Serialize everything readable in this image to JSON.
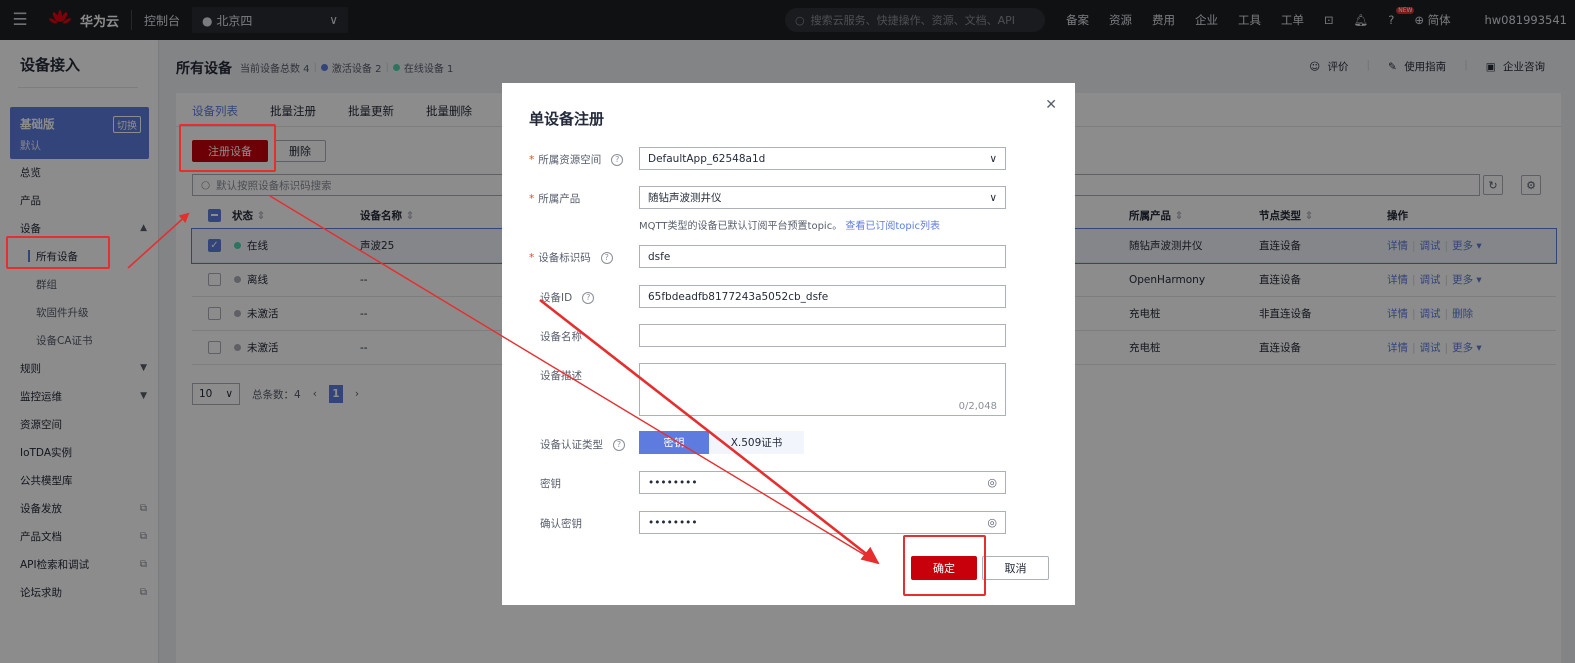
{
  "topbar": {
    "brand": "华为云",
    "console": "控制台",
    "region": "北京四",
    "search_placeholder": "搜索云服务、快捷操作、资源、文档、API",
    "nav": [
      "备案",
      "资源",
      "费用",
      "企业",
      "工具",
      "工单"
    ],
    "new_badge": "NEW",
    "language": "简体",
    "user": "hw081993541"
  },
  "sidebar": {
    "title": "设备接入",
    "edition": {
      "name": "基础版",
      "sub": "默认",
      "switch": "切换"
    },
    "items": [
      {
        "label": "总览",
        "type": "top"
      },
      {
        "label": "产品",
        "type": "top"
      },
      {
        "label": "设备",
        "type": "top",
        "arrow": "▲"
      },
      {
        "label": "所有设备",
        "type": "sub",
        "active": true
      },
      {
        "label": "群组",
        "type": "sub"
      },
      {
        "label": "软固件升级",
        "type": "sub"
      },
      {
        "label": "设备CA证书",
        "type": "sub"
      },
      {
        "label": "规则",
        "type": "top",
        "arrow": "▼"
      },
      {
        "label": "监控运维",
        "type": "top",
        "arrow": "▼"
      },
      {
        "label": "资源空间",
        "type": "top"
      },
      {
        "label": "IoTDA实例",
        "type": "top"
      },
      {
        "label": "公共模型库",
        "type": "top"
      },
      {
        "label": "设备发放",
        "type": "top",
        "ext": true
      },
      {
        "label": "产品文档",
        "type": "top",
        "ext": true
      },
      {
        "label": "API检索和调试",
        "type": "top",
        "ext": true
      },
      {
        "label": "论坛求助",
        "type": "top",
        "ext": true
      }
    ]
  },
  "page": {
    "title": "所有设备",
    "stats_total": "当前设备总数 4",
    "stats_active": "激活设备 2",
    "stats_online": "在线设备 1",
    "links": [
      "评价",
      "使用指南",
      "企业咨询"
    ]
  },
  "tabs": [
    "设备列表",
    "批量注册",
    "批量更新",
    "批量删除"
  ],
  "toolbar": {
    "register": "注册设备",
    "delete": "删除"
  },
  "search": {
    "placeholder": "默认按照设备标识码搜索"
  },
  "table": {
    "headers": {
      "status": "状态",
      "name": "设备名称",
      "product": "所属产品",
      "node": "节点类型",
      "ops": "操作"
    },
    "rows": [
      {
        "status": "在线",
        "status_color": "#50d4ab",
        "name": "声波25",
        "product": "随钻声波测井仪",
        "node": "直连设备",
        "ops": [
          "详情",
          "调试",
          "更多 ▾"
        ],
        "checked": true
      },
      {
        "status": "离线",
        "status_color": "#adb0b8",
        "name": "--",
        "product": "OpenHarmony",
        "node": "直连设备",
        "ops": [
          "详情",
          "调试",
          "更多 ▾"
        ],
        "checked": false
      },
      {
        "status": "未激活",
        "status_color": "#adb0b8",
        "name": "--",
        "product": "充电桩",
        "node": "非直连设备",
        "ops": [
          "详情",
          "调试",
          "删除"
        ],
        "checked": false
      },
      {
        "status": "未激活",
        "status_color": "#adb0b8",
        "name": "--",
        "product": "充电桩",
        "node": "直连设备",
        "ops": [
          "详情",
          "调试",
          "更多 ▾"
        ],
        "checked": false
      }
    ]
  },
  "pager": {
    "size": "10",
    "total": "总条数：4",
    "current": "1"
  },
  "dialog": {
    "title": "单设备注册",
    "fields": {
      "space_label": "所属资源空间",
      "space_value": "DefaultApp_62548a1d",
      "product_label": "所属产品",
      "product_value": "随钻声波测井仪",
      "product_hint": "MQTT类型的设备已默认订阅平台预置topic。",
      "product_hint_link": "查看已订阅topic列表",
      "identifier_label": "设备标识码",
      "identifier_value": "dsfe",
      "deviceid_label": "设备ID",
      "deviceid_value": "65fbdeadfb8177243a5052cb_dsfe",
      "name_label": "设备名称",
      "name_value": "",
      "desc_label": "设备描述",
      "desc_count": "0/2,048",
      "auth_label": "设备认证类型",
      "auth_options": [
        "密钥",
        "X.509证书"
      ],
      "secret_label": "密钥",
      "secret_value": "••••••••",
      "confirm_label": "确认密钥",
      "confirm_value": "••••••••"
    },
    "ok": "确定",
    "cancel": "取消"
  },
  "colors": {
    "accent": "#5e7ce0",
    "brand_red": "#c7000b",
    "annotation_red": "#e62e2e",
    "online": "#50d4ab"
  }
}
